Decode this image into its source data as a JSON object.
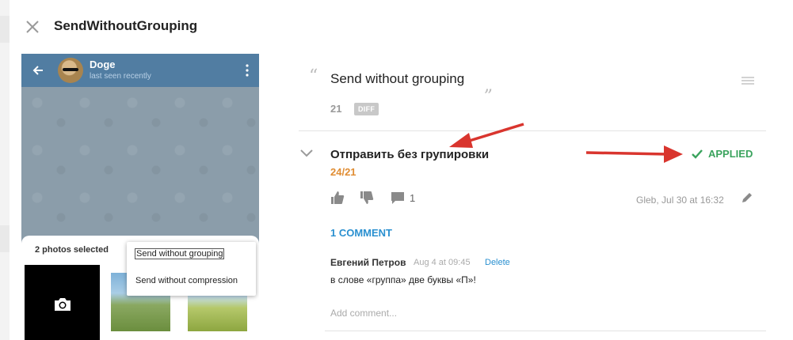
{
  "header": {
    "title": "SendWithoutGrouping",
    "close_icon": "close-icon"
  },
  "phone": {
    "chat_name": "Doge",
    "chat_status": "last seen recently",
    "header_color": "#517da2",
    "sheet": {
      "title": "2 photos selected",
      "menu": [
        "Send without grouping",
        "Send without compression"
      ]
    }
  },
  "source": {
    "text": "Send without grouping",
    "char_count": "21",
    "diff_label": "DIFF"
  },
  "translation": {
    "text": "Отправить без групировки",
    "count": "24/21",
    "status": "APPLIED",
    "status_color": "#3aa35d",
    "comment_count": "1",
    "author_date": "Gleb, Jul 30 at 16:32"
  },
  "comments": {
    "link_label": "1 COMMENT",
    "items": [
      {
        "author": "Евгений Петров",
        "date": "Aug 4 at 09:45",
        "delete_label": "Delete",
        "text": "в слове «группа» две буквы «П»!"
      }
    ],
    "add_placeholder": "Add comment..."
  },
  "annotation_color": "#d9352e"
}
